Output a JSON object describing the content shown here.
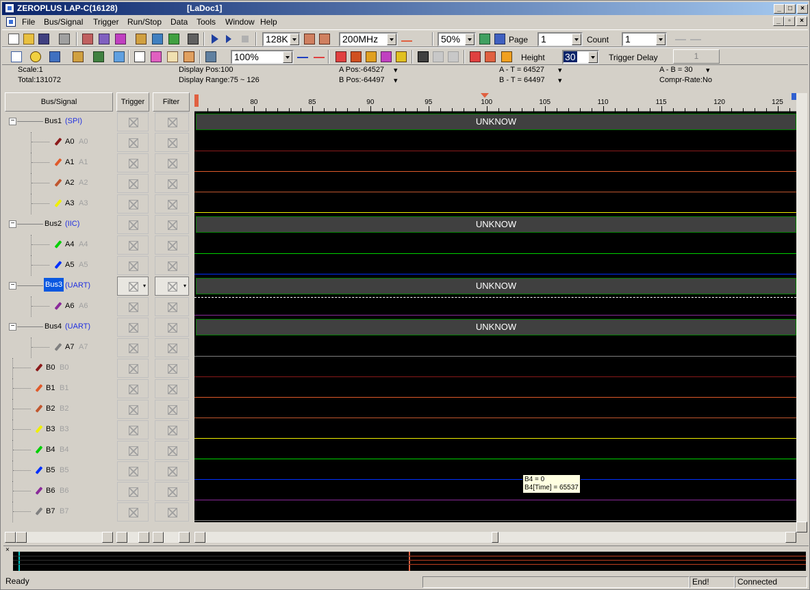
{
  "window": {
    "app_title": "ZEROPLUS LAP-C(16128)",
    "doc_title": "[LaDoc1]"
  },
  "menu": [
    "File",
    "Bus/Signal",
    "Trigger",
    "Run/Stop",
    "Data",
    "Tools",
    "Window",
    "Help"
  ],
  "toolbar1": {
    "memory_depth": "128K",
    "sample_rate": "200MHz",
    "zoom_percent": "50%",
    "page_label": "Page",
    "page_value": "1",
    "count_label": "Count",
    "count_value": "1"
  },
  "toolbar2": {
    "scale_percent": "100%",
    "height_label": "Height",
    "height_value": "30",
    "trigger_delay_label": "Trigger Delay",
    "trigger_delay_value": "1"
  },
  "info": {
    "scale": "Scale:1",
    "total": "Total:131072",
    "display_pos": "Display Pos:100",
    "display_range": "Display Range:75 ~ 126",
    "a_pos": "A Pos:-64527",
    "b_pos": "B Pos:-64497",
    "a_t": "A - T = 64527",
    "b_t": "B - T = 64497",
    "a_b": "A - B = 30",
    "compr": "Compr-Rate:No"
  },
  "headers": {
    "bus_signal": "Bus/Signal",
    "trigger": "Trigger",
    "filter": "Filter"
  },
  "ruler": [
    "80",
    "85",
    "90",
    "95",
    "100",
    "105",
    "110",
    "115",
    "120",
    "125"
  ],
  "tree": [
    {
      "label": "Bus1",
      "suffix": "(SPI)",
      "type": "bus",
      "level": 0
    },
    {
      "label": "A0",
      "alias": "A0",
      "type": "sig",
      "level": 1,
      "color": "#8b1a1a"
    },
    {
      "label": "A1",
      "alias": "A1",
      "type": "sig",
      "level": 1,
      "color": "#e05a2a"
    },
    {
      "label": "A2",
      "alias": "A2",
      "type": "sig",
      "level": 1,
      "color": "#c0562e"
    },
    {
      "label": "A3",
      "alias": "A3",
      "type": "sig",
      "level": 1,
      "color": "#f0f000"
    },
    {
      "label": "Bus2",
      "suffix": "(IIC)",
      "type": "bus",
      "level": 0
    },
    {
      "label": "A4",
      "alias": "A4",
      "type": "sig",
      "level": 1,
      "color": "#00d000"
    },
    {
      "label": "A5",
      "alias": "A5",
      "type": "sig",
      "level": 1,
      "color": "#0030ff"
    },
    {
      "label": "Bus3",
      "suffix": "(UART)",
      "type": "bus",
      "level": 0,
      "selected": true
    },
    {
      "label": "A6",
      "alias": "A6",
      "type": "sig",
      "level": 1,
      "color": "#8a2a9a"
    },
    {
      "label": "Bus4",
      "suffix": "(UART)",
      "type": "bus",
      "level": 0
    },
    {
      "label": "A7",
      "alias": "A7",
      "type": "sig",
      "level": 1,
      "color": "#808080"
    },
    {
      "label": "B0",
      "alias": "B0",
      "type": "sig",
      "level": 0,
      "color": "#8b1a1a"
    },
    {
      "label": "B1",
      "alias": "B1",
      "type": "sig",
      "level": 0,
      "color": "#e05a2a"
    },
    {
      "label": "B2",
      "alias": "B2",
      "type": "sig",
      "level": 0,
      "color": "#c0562e"
    },
    {
      "label": "B3",
      "alias": "B3",
      "type": "sig",
      "level": 0,
      "color": "#f0f000"
    },
    {
      "label": "B4",
      "alias": "B4",
      "type": "sig",
      "level": 0,
      "color": "#00d000"
    },
    {
      "label": "B5",
      "alias": "B5",
      "type": "sig",
      "level": 0,
      "color": "#0030ff"
    },
    {
      "label": "B6",
      "alias": "B6",
      "type": "sig",
      "level": 0,
      "color": "#8a2a9a"
    },
    {
      "label": "B7",
      "alias": "B7",
      "type": "sig",
      "level": 0,
      "color": "#808080"
    }
  ],
  "bus_value": "UNKNOW",
  "tooltip": {
    "line1": "B4 = 0",
    "line2": "B4[Time] = 65537"
  },
  "status": {
    "ready": "Ready",
    "end": "End!",
    "connected": "Connected"
  }
}
